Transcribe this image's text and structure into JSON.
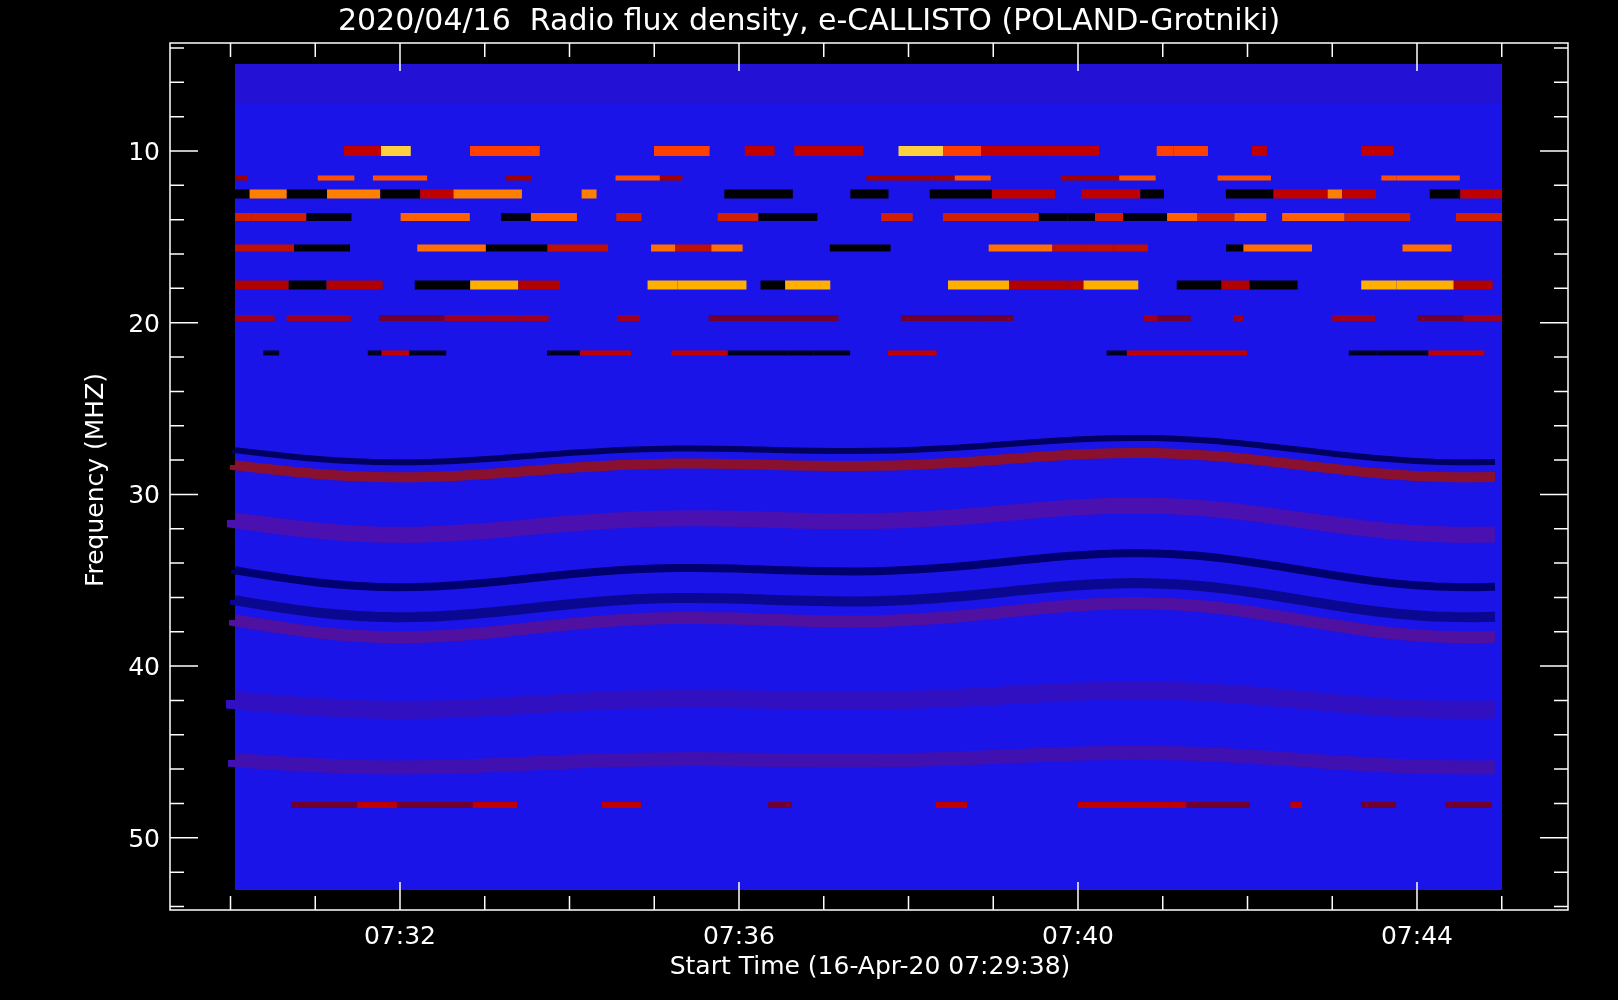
{
  "title": "2020/04/16  Radio flux density, e-CALLISTO (POLAND-Grotniki)",
  "y_axis": {
    "label": "Frequency (MHZ)",
    "ticks": [
      "10",
      "20",
      "30",
      "40",
      "50"
    ]
  },
  "x_axis": {
    "label": "Start Time (16-Apr-20 07:29:38)",
    "ticks": [
      "07:32",
      "07:36",
      "07:40",
      "07:44"
    ]
  }
}
